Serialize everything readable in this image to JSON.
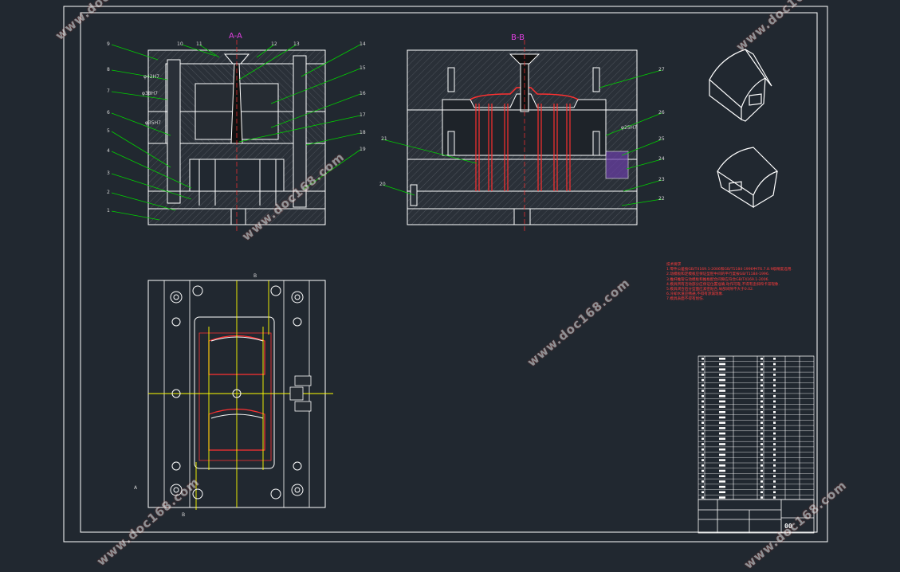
{
  "drawing": {
    "section_a_title": "A-A",
    "section_b_title": "B-B",
    "marker_a": "A",
    "marker_b": "B",
    "part_numbers_left": [
      "9",
      "8",
      "7",
      "6",
      "5",
      "4",
      "3",
      "2",
      "1"
    ],
    "part_numbers_top": [
      "10",
      "11",
      "12",
      "13",
      "14"
    ],
    "part_numbers_right": [
      "15",
      "16",
      "17",
      "18",
      "19"
    ],
    "part_numbers_bb_right": [
      "27",
      "26",
      "25",
      "24",
      "23",
      "22"
    ],
    "part_numbers_bb_left": [
      "21",
      "20"
    ],
    "dim_labels": [
      "φ42H7",
      "φ38H7",
      "φ35H7",
      "φ25H7"
    ],
    "drawing_number": "00",
    "tech_notes_title": "技术要求",
    "tech_notes": [
      "1.零件公差按GB/T4169.1-2006和GB/T1184-1996中IT6.7.8.9级精度选用.",
      "2.动模板和定模板应保证型腔中间的平行度按GB/T1184-1996.",
      "3.推杆推管与动模板和推板配合间隙应符合GB/T4169.1-2006.",
      "4.模具所有活动部分应保证位置准确,动作可靠,不得有歪斜和卡滞现象.",
      "5.模具闭合后分型面应紧密贴合,局部间隙不大于0.02.",
      "6.冷却水道应畅通,不得有渗漏现象.",
      "7.模具表面不得有划伤."
    ]
  },
  "watermarks": [
    "www.doc168.com",
    "www.doc168.com",
    "www.doc168.com",
    "www.doc168.com",
    "www.doc168.com",
    "www.doc168.com"
  ],
  "colors": {
    "background": "#212830",
    "outline": "#ffffff",
    "leader": "#00d000",
    "section": "#e040e0",
    "hidden": "#ff3030",
    "center": "#ffff00",
    "hatch": "#3a3f46"
  }
}
